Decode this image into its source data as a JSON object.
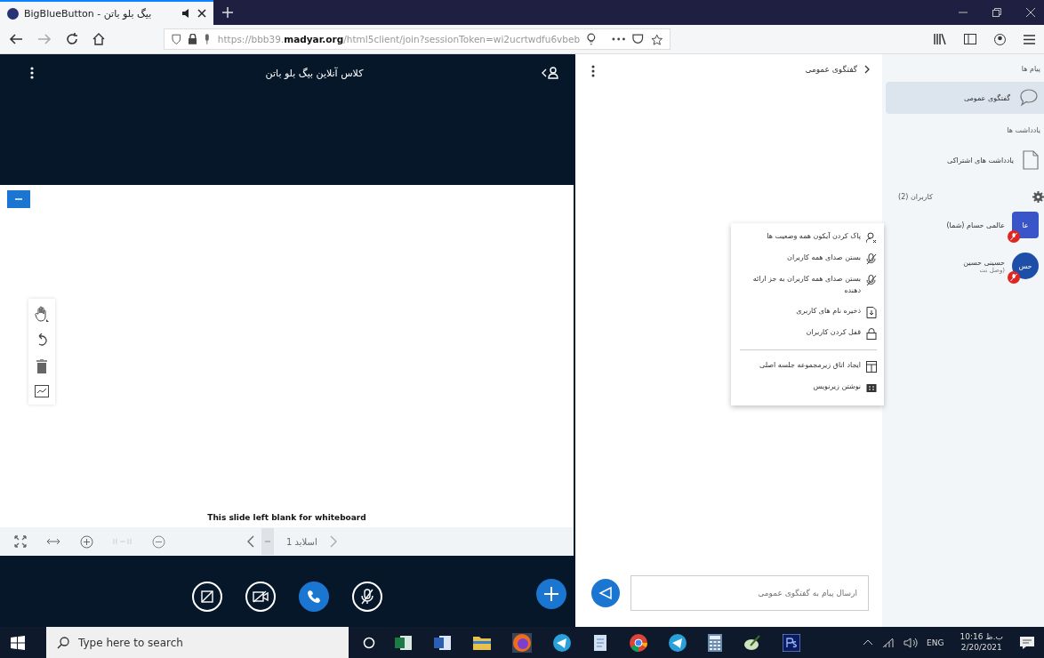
{
  "browser": {
    "tab": {
      "title": "BigBlueButton - بیگ بلو باتن",
      "selected": true
    },
    "url_host": "https://bbb39.",
    "url_domain": "madyar.org",
    "url_path": "/html5client/join?sessionToken=wi2ucrtwdfu6vbeb"
  },
  "presentation": {
    "title": "کلاس آنلاین بیگ بلو باتن",
    "slide_text": "This slide left blank for whiteboard",
    "slide_label": "اسلاید 1"
  },
  "actions": [
    {
      "kind": "screen",
      "active": false
    },
    {
      "kind": "camera",
      "active": false
    },
    {
      "kind": "phone",
      "active": true
    },
    {
      "kind": "mic",
      "active": false
    }
  ],
  "chat": {
    "title": "گفتگوی عمومی",
    "placeholder": "ارسال پیام به گفتگوی عمومی"
  },
  "user_menu": [
    {
      "kind": "status",
      "label": "پاک کردن آیکون همه وضعیت ها"
    },
    {
      "kind": "mute",
      "label": "بستن صدای همه کاربران"
    },
    {
      "kind": "mute",
      "label": "بستن صدای همه کاربران به جز ارائه دهنده"
    },
    {
      "kind": "save",
      "label": "ذخیره نام های کاربری"
    },
    {
      "kind": "lock",
      "label": "قفل کردن کاربران"
    },
    {
      "kind": "breakout",
      "label": "ایجاد اتاق زیرمجموعه جلسه اصلی"
    },
    {
      "kind": "captions",
      "label": "نوشتن زیرنویس"
    }
  ],
  "sidebar": {
    "messages_heading": "پیام ها",
    "chats": [
      {
        "label": "گفتگوی عمومی",
        "selected": true
      }
    ],
    "notes_heading": "یادداشت ها",
    "notes": [
      {
        "label": "یادداشت های اشتراکی",
        "selected": false
      }
    ],
    "users_heading": "کاربران (2)",
    "users": [
      {
        "name": "عالمی حسام (شما)",
        "initials": "عا",
        "color": "#3a55c8",
        "muted": true,
        "square": true
      },
      {
        "name": "حسینی حسین",
        "initials": "حس",
        "status": "(وصل نت",
        "color": "#1d4fa8",
        "muted": true,
        "square": false
      }
    ]
  },
  "taskbar": {
    "search_placeholder": "Type here to search",
    "language": "ENG",
    "time": "10:16 ب.ظ",
    "date": "2/20/2021"
  }
}
